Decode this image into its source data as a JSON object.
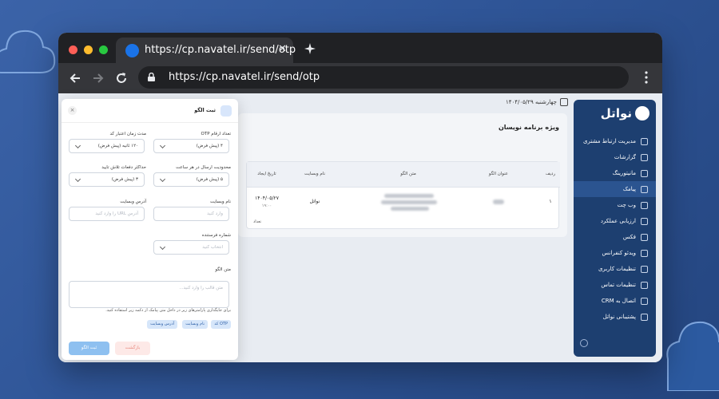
{
  "browser": {
    "tab_title": "https://cp.navatel.ir/send/otp",
    "tab_close": "✕",
    "url": "https://cp.navatel.ir/send/otp"
  },
  "sidebar": {
    "brand": "نواتل",
    "items": [
      {
        "label": "مدیریت ارتباط مشتری",
        "icon": "users-icon"
      },
      {
        "label": "گزارشات",
        "icon": "report-icon"
      },
      {
        "label": "مانیتورینگ",
        "icon": "monitor-icon"
      },
      {
        "label": "پیامک",
        "icon": "send-icon",
        "active": true
      },
      {
        "label": "وب چت",
        "icon": "chat-icon"
      },
      {
        "label": "ارزیابی عملکرد",
        "icon": "clipboard-icon"
      },
      {
        "label": "فکس",
        "icon": "fax-icon"
      },
      {
        "label": "ویدئو کنفرانس",
        "icon": "video-icon"
      },
      {
        "label": "تنظیمات کاربری",
        "icon": "user-settings-icon"
      },
      {
        "label": "تنظیمات تماس",
        "icon": "call-settings-icon"
      },
      {
        "label": "اتصال به CRM",
        "icon": "link-icon"
      },
      {
        "label": "پشتیبانی نواتل",
        "icon": "support-icon"
      }
    ]
  },
  "header": {
    "date": "چهارشنبه ۱۴۰۴/۰۵/۲۹"
  },
  "card": {
    "title": "ویژه برنامه نویسان",
    "columns": [
      "ردیف",
      "عنوان الگو",
      "متن الگو",
      "نام وبسایت",
      "تاریخ ایجاد"
    ],
    "rows": [
      {
        "index": "۱",
        "website": "نواتل",
        "date": "۱۴۰۴/۰۵/۲۷",
        "time": "۱۹:۰۰"
      }
    ],
    "footer_fragment": "تعداد"
  },
  "modal": {
    "title": "ثبت الگو",
    "close": "×",
    "otp_digits": {
      "label": "تعداد ارقام OTP",
      "value": "۴ (پیش فرض)"
    },
    "validity": {
      "label": "مدت زمان اعتبار کد",
      "value": "۱۲۰ ثانیه (پیش فرض)"
    },
    "rate_limit": {
      "label": "محدودیت ارسال در هر ساعت",
      "value": "۵ (پیش فرض)"
    },
    "max_attempts": {
      "label": "حداکثر دفعات تلاش تایید",
      "value": "۳ (پیش فرض)"
    },
    "site_name": {
      "label": "نام وبسایت",
      "placeholder": "وارد کنید"
    },
    "site_address": {
      "label": "آدرس وبسایت",
      "placeholder": "آدرس URL را وارد کنید"
    },
    "sender": {
      "label": "شماره فرستنده",
      "placeholder": "انتخاب کنید"
    },
    "pattern_text": {
      "label": "متن الگو",
      "placeholder": "متن قالب را وارد کنید..."
    },
    "hint": "برای جایگذاری پارامترهای زیر در داخل متن پیامک از دکمه زیر استفاده کنید.",
    "chips": [
      "کد OTP",
      "نام وبسایت",
      "آدرس وبسایت"
    ],
    "submit": "ثبت الگو",
    "back": "بازگشت"
  },
  "colors": {
    "sidebar": "#1d3f70",
    "primary_button": "#8ec0f0",
    "back_button": "#fde9e7"
  }
}
